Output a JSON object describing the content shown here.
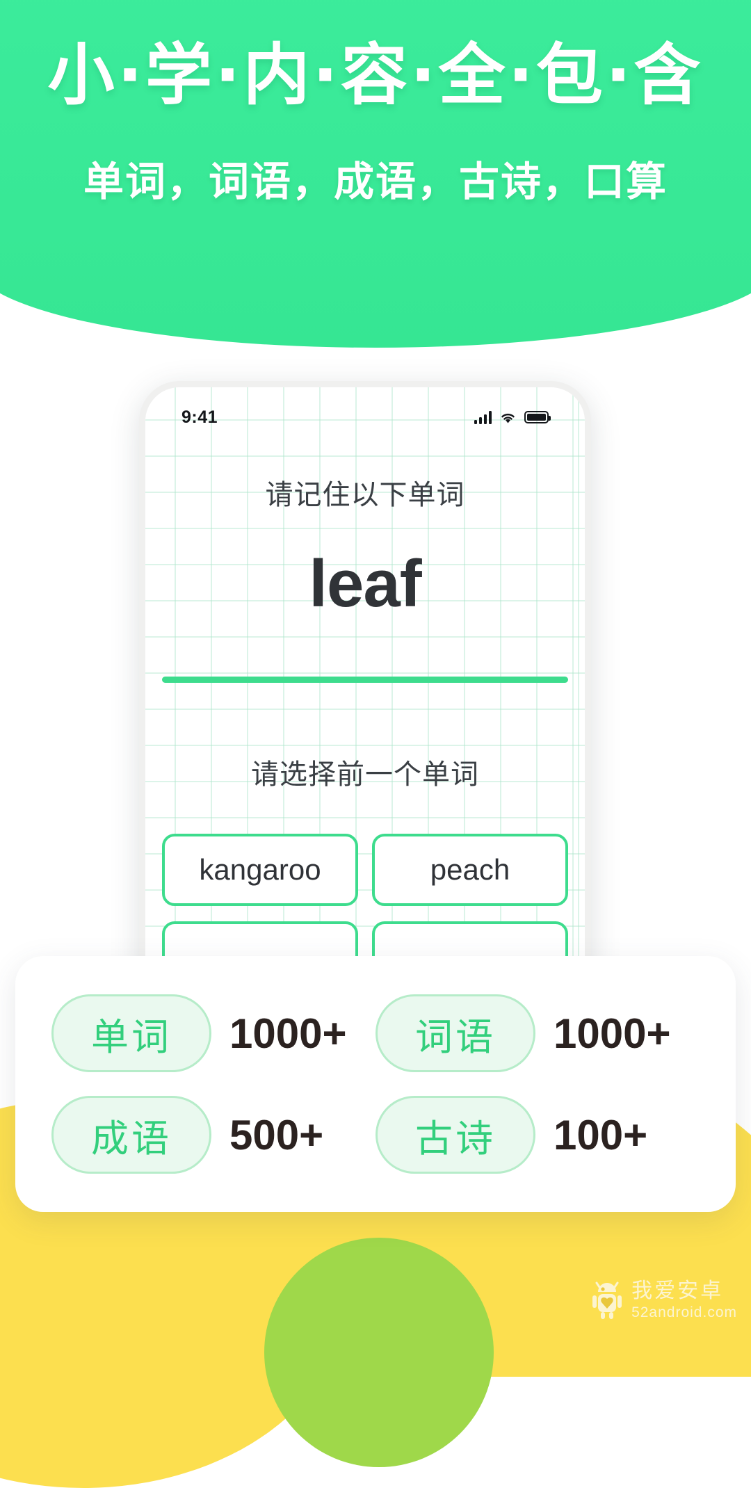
{
  "header": {
    "headline": "小·学·内·容·全·包·含",
    "headline_plain": "小学内容全包含",
    "subline": "单词，词语，成语，古诗，口算",
    "bg_color": "#3aeb9a"
  },
  "phone": {
    "status": {
      "time": "9:41",
      "signal_icon": "signal-bars-icon",
      "wifi_icon": "wifi-icon",
      "battery_icon": "battery-full-icon"
    },
    "screen": {
      "prompt_memorize": "请记住以下单词",
      "word": "leaf",
      "divider_color": "#3ddc8d",
      "prompt_choose": "请选择前一个单词",
      "options": [
        {
          "label": "kangaroo"
        },
        {
          "label": "peach"
        },
        {
          "label": ""
        },
        {
          "label": ""
        }
      ]
    }
  },
  "stats_card": {
    "items": [
      {
        "label": "单词",
        "value": "1000+"
      },
      {
        "label": "词语",
        "value": "1000+"
      },
      {
        "label": "成语",
        "value": "500+"
      },
      {
        "label": "古诗",
        "value": "100+"
      }
    ],
    "pill_bg": "#eaf9ef",
    "pill_text_color": "#32cf7c"
  },
  "watermark": {
    "cn": "我爱安卓",
    "en": "52android.com",
    "icon": "android-robot-icon"
  },
  "decor": {
    "yellow": "#fcdf4f",
    "lime": "#9fd84a"
  }
}
